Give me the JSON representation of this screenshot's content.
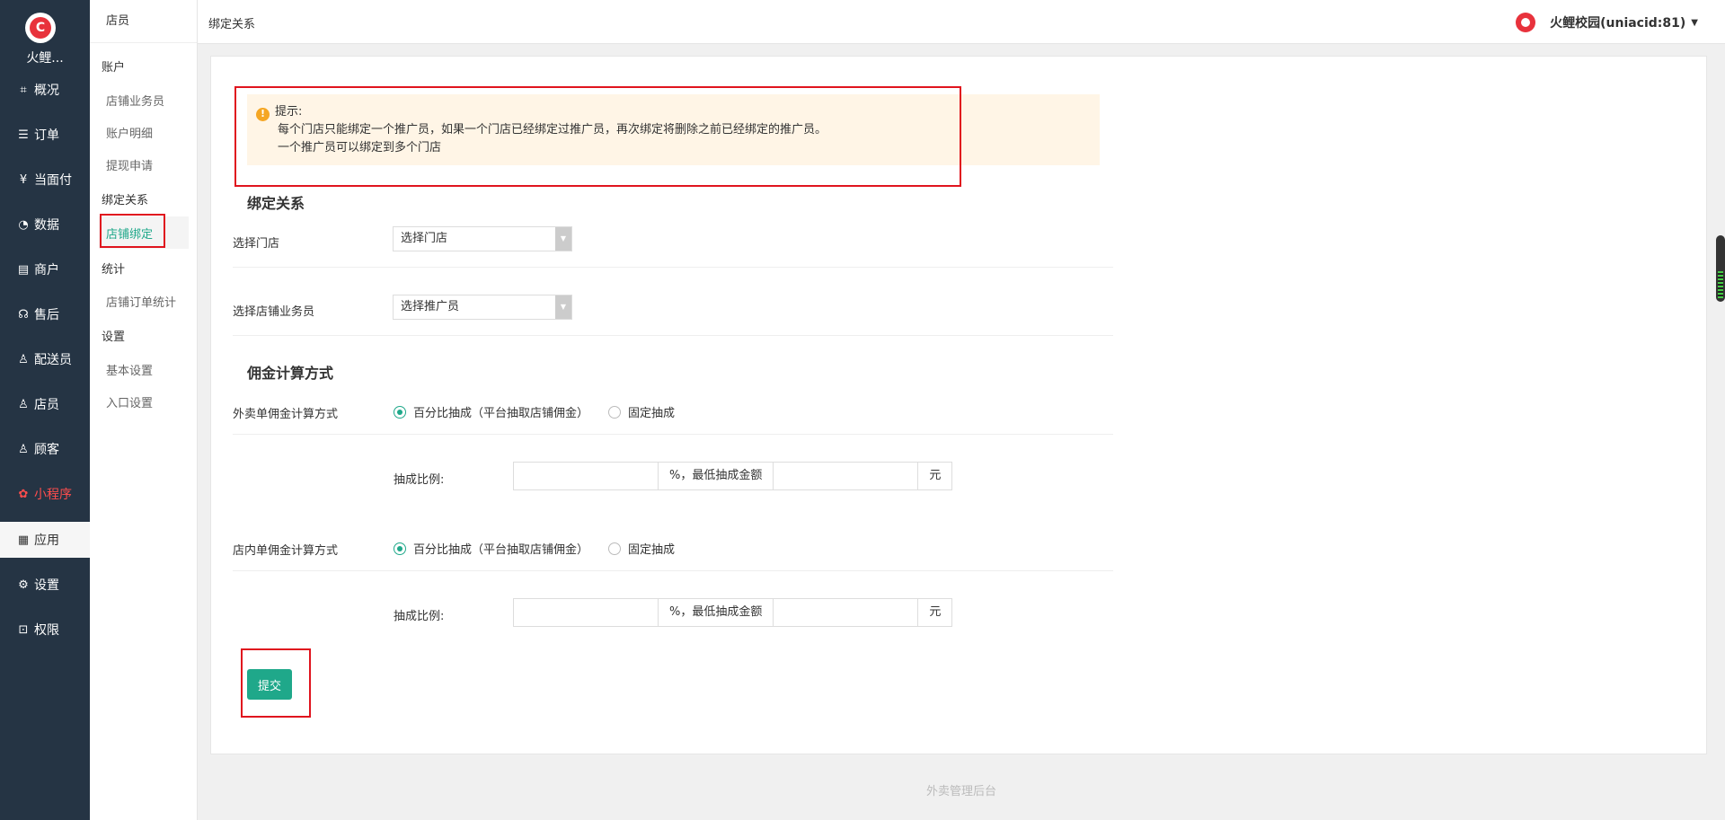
{
  "nav": {
    "brand": "火鲤...",
    "items": [
      {
        "label": "概况",
        "icon": "overview-icon",
        "glyph": "⌗"
      },
      {
        "label": "订单",
        "icon": "order-icon",
        "glyph": "☰"
      },
      {
        "label": "当面付",
        "icon": "yen-icon",
        "glyph": "¥"
      },
      {
        "label": "数据",
        "icon": "chart-icon",
        "glyph": "◔"
      },
      {
        "label": "商户",
        "icon": "store-icon",
        "glyph": "▤"
      },
      {
        "label": "售后",
        "icon": "headset-icon",
        "glyph": "☊"
      },
      {
        "label": "配送员",
        "icon": "courier-icon",
        "glyph": "♙"
      },
      {
        "label": "店员",
        "icon": "clerk-icon",
        "glyph": "♙"
      },
      {
        "label": "顾客",
        "icon": "customer-icon",
        "glyph": "♙"
      },
      {
        "label": "小程序",
        "icon": "miniprogram-icon",
        "glyph": "✿"
      },
      {
        "label": "应用",
        "icon": "apps-icon",
        "glyph": "▦"
      },
      {
        "label": "设置",
        "icon": "settings-icon",
        "glyph": "⚙"
      },
      {
        "label": "权限",
        "icon": "lock-icon",
        "glyph": "⊡"
      }
    ]
  },
  "side": {
    "title": "店员",
    "groups": {
      "account": "账户",
      "binding": "绑定关系",
      "stats": "统计",
      "settings": "设置"
    },
    "links": {
      "salesman": "店铺业务员",
      "account_detail": "账户明细",
      "withdraw": "提现申请",
      "store_binding": "店铺绑定",
      "order_stats": "店铺订单统计",
      "basic_settings": "基本设置",
      "entry_settings": "入口设置"
    }
  },
  "topbar": {
    "breadcrumb": "绑定关系",
    "user": "火鲤校园(uniacid:81)"
  },
  "tip": {
    "title": "提示:",
    "line1": "每个门店只能绑定一个推广员，如果一个门店已经绑定过推广员，再次绑定将删除之前已经绑定的推广员。",
    "line2": "一个推广员可以绑定到多个门店"
  },
  "form": {
    "binding_title": "绑定关系",
    "store_label": "选择门店",
    "store_placeholder": "选择门店",
    "salesman_label": "选择店铺业务员",
    "salesman_placeholder": "选择推广员",
    "commission_title": "佣金计算方式",
    "takeout_label": "外卖单佣金计算方式",
    "instore_label": "店内单佣金计算方式",
    "option_percent": "百分比抽成（平台抽取店铺佣金）",
    "option_fixed": "固定抽成",
    "ratio_label": "抽成比例:",
    "min_addon": "%，最低抽成金额",
    "yuan_addon": "元",
    "submit": "提交"
  },
  "footer": "外卖管理后台",
  "colors": {
    "nav_bg": "#253444",
    "accent": "#1fa88a",
    "highlight_red": "#e0141e",
    "tip_bg": "#fff5e6"
  }
}
